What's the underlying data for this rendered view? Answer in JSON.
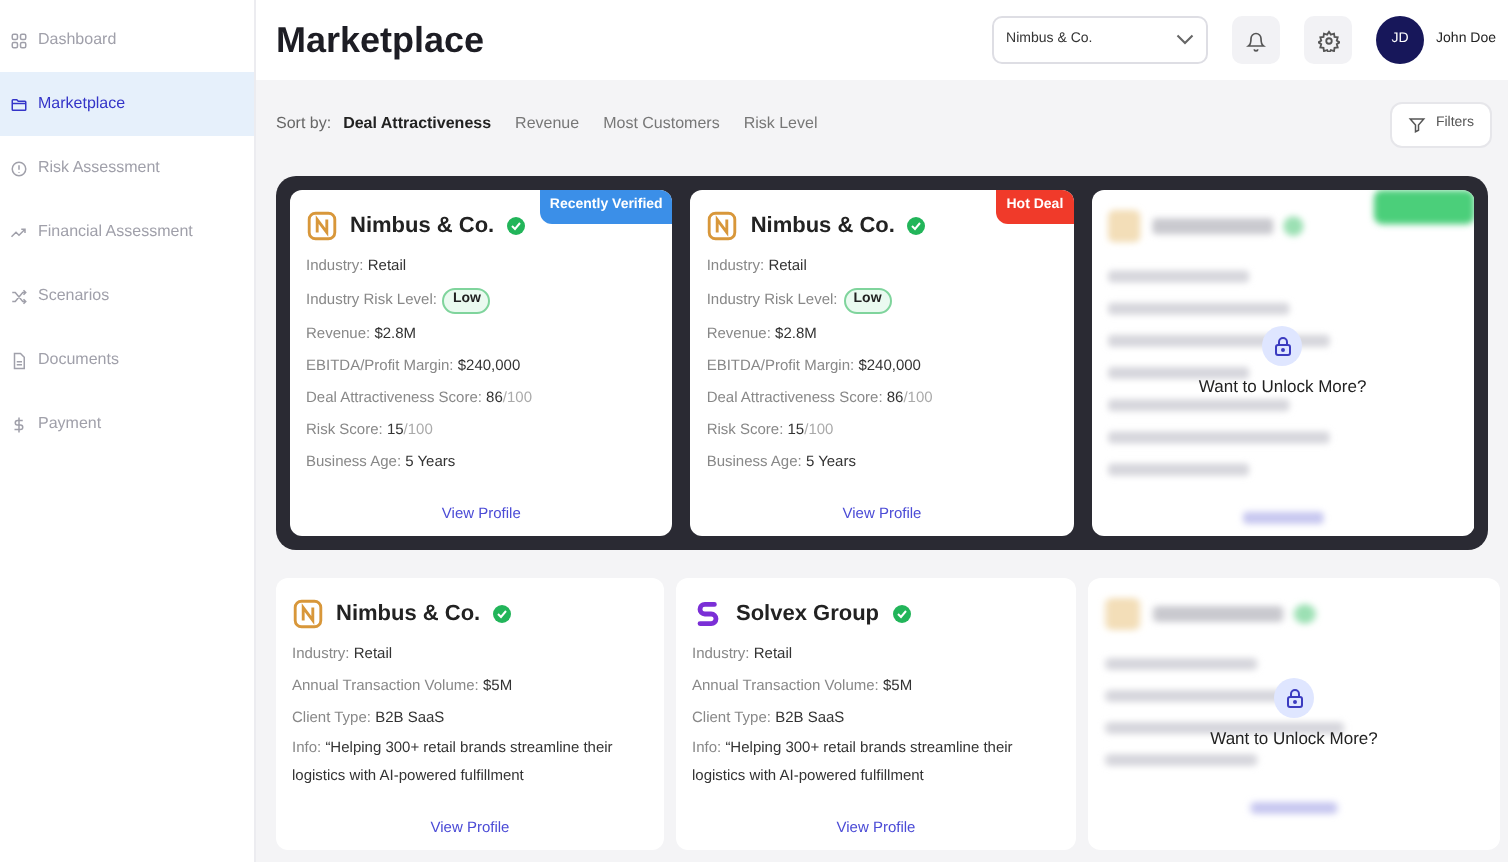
{
  "sidebar": {
    "items": [
      {
        "label": "Dashboard",
        "selected": false
      },
      {
        "label": "Marketplace",
        "selected": true
      },
      {
        "label": "Risk Assessment",
        "selected": false
      },
      {
        "label": "Financial Assessment",
        "selected": false
      },
      {
        "label": "Scenarios",
        "selected": false
      },
      {
        "label": "Documents",
        "selected": false
      },
      {
        "label": "Payment",
        "selected": false
      }
    ]
  },
  "header": {
    "title": "Marketplace",
    "company_select": {
      "value": "Nimbus & Co."
    },
    "user": {
      "initials": "JD",
      "name": "John Doe"
    }
  },
  "sort": {
    "label": "Sort by:",
    "options": [
      {
        "label": "Deal Attractiveness",
        "selected": true
      },
      {
        "label": "Revenue",
        "selected": false
      },
      {
        "label": "Most Customers",
        "selected": false
      },
      {
        "label": "Risk Level",
        "selected": false
      }
    ],
    "filters_button": "Filters"
  },
  "featured": {
    "cards": [
      {
        "kind": "full",
        "name": "Nimbus & Co.",
        "verified": true,
        "ribbon": {
          "label": "Recently Verified",
          "color": "#3b8fe8"
        },
        "fields": [
          {
            "label": "Industry:",
            "value": "Retail"
          },
          {
            "label": "Industry Risk Level:",
            "value": "Low",
            "kind": "badge"
          },
          {
            "label": "Revenue:",
            "value": "$2.8M"
          },
          {
            "label": "EBITDA/Profit Margin:",
            "value": "$240,000"
          },
          {
            "label": "Deal Attractiveness Score:",
            "value": "86",
            "out_of": "/100"
          },
          {
            "label": "Risk Score:",
            "value": "15",
            "out_of": "/100"
          },
          {
            "label": "Business Age:",
            "value": "5 Years"
          }
        ],
        "link": "View Profile"
      },
      {
        "kind": "full",
        "name": "Nimbus & Co.",
        "verified": true,
        "ribbon": {
          "label": "Hot Deal",
          "color": "#f03a2a"
        },
        "fields": [
          {
            "label": "Industry:",
            "value": "Retail"
          },
          {
            "label": "Industry Risk Level:",
            "value": "Low",
            "kind": "badge"
          },
          {
            "label": "Revenue:",
            "value": "$2.8M"
          },
          {
            "label": "EBITDA/Profit Margin:",
            "value": "$240,000"
          },
          {
            "label": "Deal Attractiveness Score:",
            "value": "86",
            "out_of": "/100"
          },
          {
            "label": "Risk Score:",
            "value": "15",
            "out_of": "/100"
          },
          {
            "label": "Business Age:",
            "value": "5 Years"
          }
        ],
        "link": "View Profile"
      },
      {
        "kind": "locked",
        "message": "Want to Unlock More?"
      }
    ]
  },
  "listings": {
    "cards": [
      {
        "kind": "full",
        "name": "Nimbus & Co.",
        "verified": true,
        "fields": [
          {
            "label": "Industry:",
            "value": "Retail"
          },
          {
            "label": "Annual Transaction Volume:",
            "value": "$5M"
          },
          {
            "label": "Client Type:",
            "value": "B2B SaaS"
          },
          {
            "label": "Info:",
            "value": "“Helping 300+ retail brands streamline their logistics with AI-powered fulfillment",
            "kind": "wrap"
          }
        ],
        "link": "View Profile"
      },
      {
        "kind": "full",
        "name": "Solvex Group",
        "verified": true,
        "fields": [
          {
            "label": "Industry:",
            "value": "Retail"
          },
          {
            "label": "Annual Transaction Volume:",
            "value": "$5M"
          },
          {
            "label": "Client Type:",
            "value": "B2B SaaS"
          },
          {
            "label": "Info:",
            "value": "“Helping 300+ retail brands streamline their logistics with AI-powered fulfillment",
            "kind": "wrap"
          }
        ],
        "link": "View Profile"
      },
      {
        "kind": "locked",
        "message": "Want to Unlock More?"
      }
    ]
  }
}
